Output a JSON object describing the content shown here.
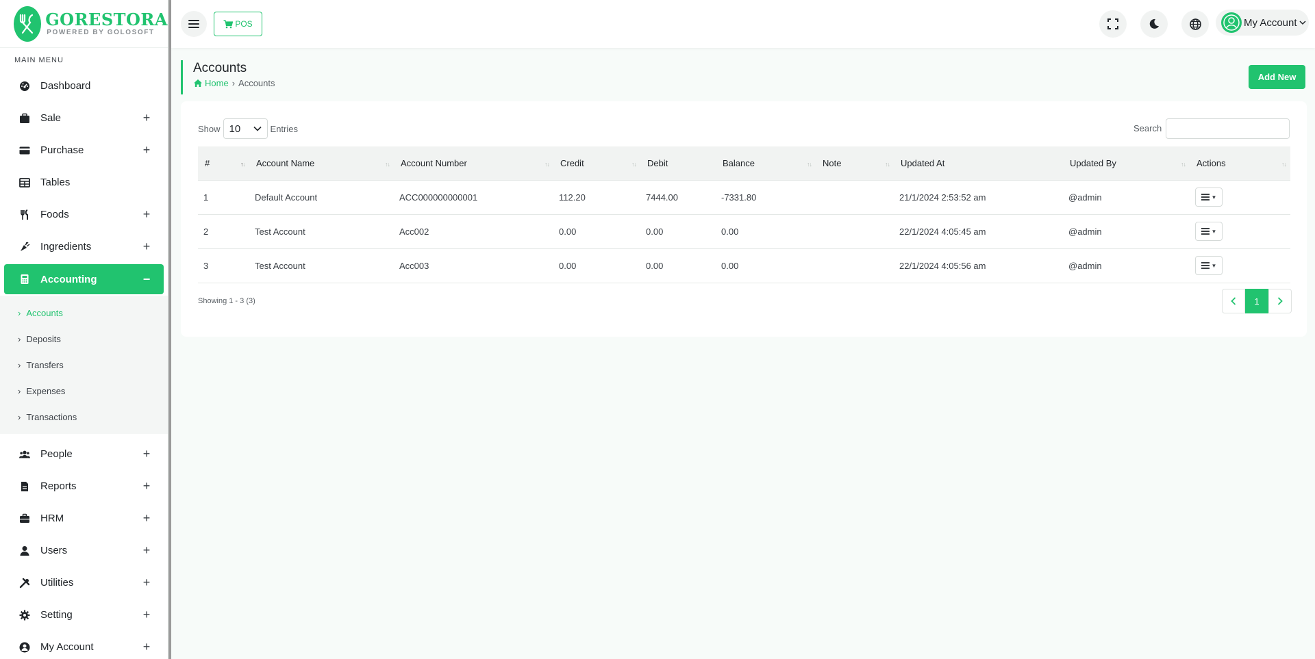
{
  "brand": {
    "name": "GORESTORA",
    "tagline": "POWERED BY GOLOSOFT"
  },
  "sidebar": {
    "caption": "MAIN MENU",
    "items": [
      {
        "label": "Dashboard",
        "icon": "dashboard-icon",
        "expandable": false
      },
      {
        "label": "Sale",
        "icon": "briefcase-icon",
        "expandable": true,
        "toggle": "+"
      },
      {
        "label": "Purchase",
        "icon": "credit-card-icon",
        "expandable": true,
        "toggle": "+"
      },
      {
        "label": "Tables",
        "icon": "table-icon",
        "expandable": false
      },
      {
        "label": "Foods",
        "icon": "utensils-icon",
        "expandable": true,
        "toggle": "+"
      },
      {
        "label": "Ingredients",
        "icon": "carrot-icon",
        "expandable": true,
        "toggle": "+"
      },
      {
        "label": "Accounting",
        "icon": "calculator-icon",
        "expandable": true,
        "toggle": "−",
        "active": true
      },
      {
        "label": "People",
        "icon": "users-icon",
        "expandable": true,
        "toggle": "+"
      },
      {
        "label": "Reports",
        "icon": "file-icon",
        "expandable": true,
        "toggle": "+"
      },
      {
        "label": "HRM",
        "icon": "toolbox-icon",
        "expandable": true,
        "toggle": "+"
      },
      {
        "label": "Users",
        "icon": "user-icon",
        "expandable": true,
        "toggle": "+"
      },
      {
        "label": "Utilities",
        "icon": "tools-icon",
        "expandable": true,
        "toggle": "+"
      },
      {
        "label": "Setting",
        "icon": "gear-icon",
        "expandable": true,
        "toggle": "+"
      },
      {
        "label": "My Account",
        "icon": "user-circle-icon",
        "expandable": true,
        "toggle": "+"
      }
    ],
    "accounting_sub": [
      "Accounts",
      "Deposits",
      "Transfers",
      "Expenses",
      "Transactions"
    ]
  },
  "header": {
    "pos_label": "POS",
    "account_label": "My Account"
  },
  "page": {
    "title": "Accounts",
    "breadcrumb_home": "Home",
    "breadcrumb_current": "Accounts",
    "add_new": "Add New"
  },
  "table": {
    "show_label": "Show",
    "entries_value": "10",
    "entries_label": "Entries",
    "search_label": "Search",
    "search_value": "",
    "columns": [
      "#",
      "Account Name",
      "Account Number",
      "Credit",
      "Debit",
      "Balance",
      "Note",
      "Updated At",
      "Updated By",
      "Actions"
    ],
    "rows": [
      {
        "no": "1",
        "name": "Default Account",
        "number": "ACC000000000001",
        "credit": "112.20",
        "debit": "7444.00",
        "balance": "-7331.80",
        "note": "",
        "updated_at": "21/1/2024 2:53:52 am",
        "updated_by": "@admin"
      },
      {
        "no": "2",
        "name": "Test Account",
        "number": "Acc002",
        "credit": "0.00",
        "debit": "0.00",
        "balance": "0.00",
        "note": "",
        "updated_at": "22/1/2024 4:05:45 am",
        "updated_by": "@admin"
      },
      {
        "no": "3",
        "name": "Test Account",
        "number": "Acc003",
        "credit": "0.00",
        "debit": "0.00",
        "balance": "0.00",
        "note": "",
        "updated_at": "22/1/2024 4:05:56 am",
        "updated_by": "@admin"
      }
    ],
    "showing": "Showing 1 - 3 (3)",
    "current_page": "1"
  },
  "colors": {
    "accent": "#21c36f",
    "background": "#f7fbf9"
  }
}
